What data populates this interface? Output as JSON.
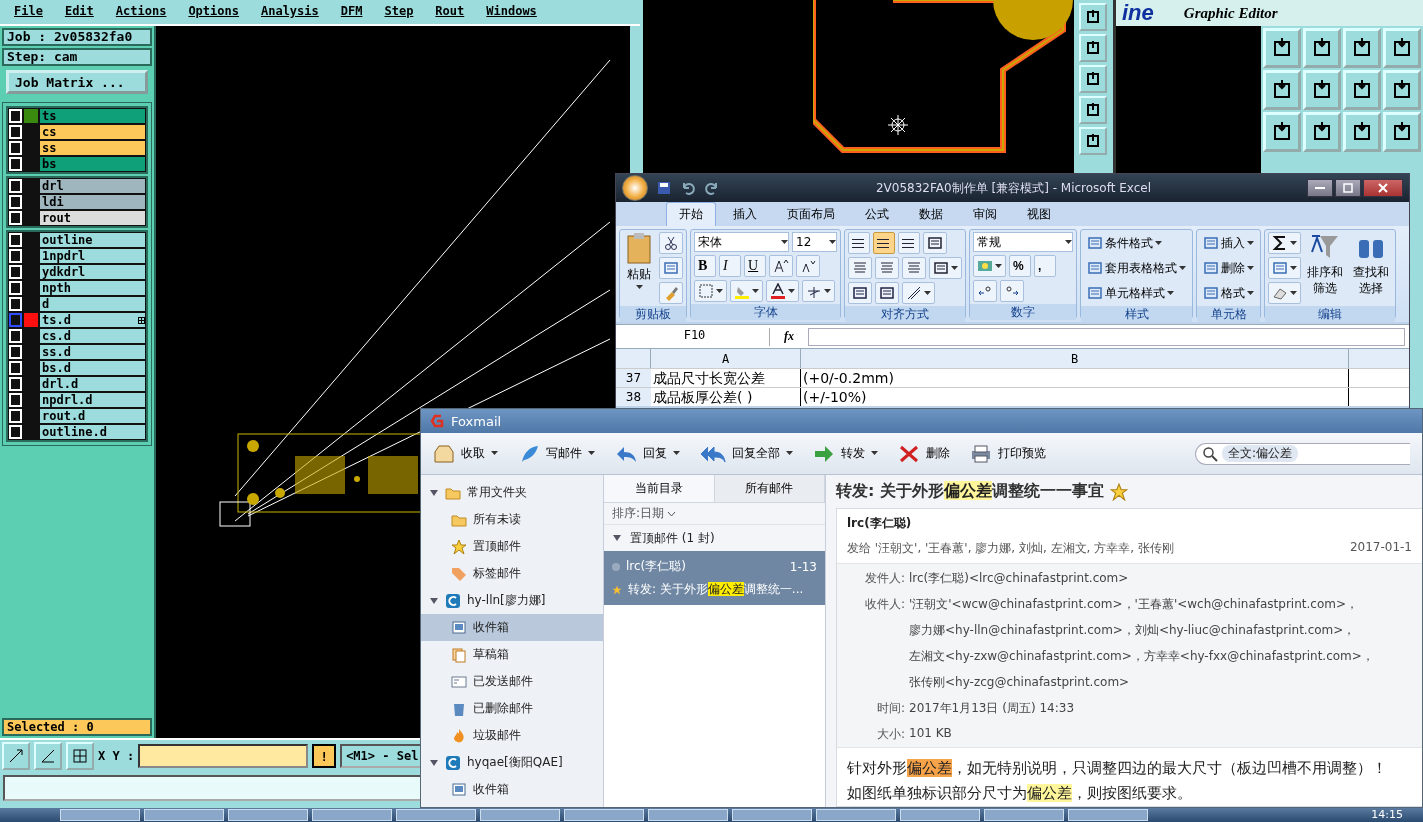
{
  "cam": {
    "menu": [
      "File",
      "Edit",
      "Actions",
      "Options",
      "Analysis",
      "DFM",
      "Step",
      "Rout",
      "Windows"
    ],
    "job": "Job : 2v05832fa0",
    "step": "Step: cam",
    "matrix_button": "Job Matrix ...",
    "layer_groups": [
      [
        {
          "name": "ts",
          "color": "#0fa07a",
          "checked": false,
          "work": true,
          "highlighted": false
        },
        {
          "name": "cs",
          "color": "#fcc85a",
          "checked": false,
          "work": false,
          "highlighted": false
        },
        {
          "name": "ss",
          "color": "#fcc85a",
          "checked": false,
          "work": false,
          "highlighted": false
        },
        {
          "name": "bs",
          "color": "#0fa07a",
          "checked": false,
          "work": false,
          "highlighted": false
        }
      ],
      [
        {
          "name": "drl",
          "color": "#a0b6be",
          "checked": false,
          "work": false,
          "highlighted": false
        },
        {
          "name": "ldi",
          "color": "#a0b6be",
          "checked": false,
          "work": false,
          "highlighted": false
        },
        {
          "name": "rout",
          "color": "#dcdcdc",
          "checked": false,
          "work": false,
          "highlighted": false
        }
      ],
      [
        {
          "name": "outline",
          "color": "#9cdcdc",
          "checked": false,
          "work": false,
          "highlighted": false
        },
        {
          "name": "1npdrl",
          "color": "#9cdcdc",
          "checked": false,
          "work": false,
          "highlighted": false
        },
        {
          "name": "ydkdrl",
          "color": "#9cdcdc",
          "checked": false,
          "work": false,
          "highlighted": false
        },
        {
          "name": "npth",
          "color": "#9cdcdc",
          "checked": false,
          "work": false,
          "highlighted": false
        },
        {
          "name": "d",
          "color": "#9cdcdc",
          "checked": false,
          "work": false,
          "highlighted": false
        },
        {
          "name": "ts.d",
          "color": "#9cdcdc",
          "checked": false,
          "work": false,
          "highlighted": true
        },
        {
          "name": "cs.d",
          "color": "#9cdcdc",
          "checked": false,
          "work": false,
          "highlighted": false
        },
        {
          "name": "ss.d",
          "color": "#9cdcdc",
          "checked": false,
          "work": false,
          "highlighted": false
        },
        {
          "name": "bs.d",
          "color": "#9cdcdc",
          "checked": false,
          "work": false,
          "highlighted": false
        },
        {
          "name": "drl.d",
          "color": "#9cdcdc",
          "checked": false,
          "work": false,
          "highlighted": false
        },
        {
          "name": "npdrl.d",
          "color": "#9cdcdc",
          "checked": false,
          "work": false,
          "highlighted": false
        },
        {
          "name": "rout.d",
          "color": "#9cdcdc",
          "checked": false,
          "work": false,
          "highlighted": false
        },
        {
          "name": "outline.d",
          "color": "#9cdcdc",
          "checked": false,
          "work": false,
          "highlighted": false
        }
      ]
    ],
    "selected_count": "Selected : 0",
    "xy_label": "X Y :",
    "alert_button": "!",
    "mode": "<M1> - Sel",
    "logo": "ine",
    "editor_title": "Graphic Editor"
  },
  "excel": {
    "title": "2V05832FA0制作单  [兼容模式] - Microsoft Excel",
    "tabs": [
      {
        "label": "开始",
        "selected": true
      },
      {
        "label": "插入",
        "selected": false
      },
      {
        "label": "页面布局",
        "selected": false
      },
      {
        "label": "公式",
        "selected": false
      },
      {
        "label": "数据",
        "selected": false
      },
      {
        "label": "审阅",
        "selected": false
      },
      {
        "label": "视图",
        "selected": false
      }
    ],
    "groups": [
      {
        "kind": "clipboard",
        "label": "剪贴板",
        "paste": "粘贴"
      },
      {
        "kind": "font",
        "label": "字体",
        "font": "宋体",
        "size": "12",
        "styles": [
          "B",
          "I",
          "U"
        ]
      },
      {
        "kind": "align",
        "label": "对齐方式",
        "buttons": [
          {
            "selected": false
          },
          {
            "selected": true
          },
          {
            "selected": false
          }
        ]
      },
      {
        "kind": "number",
        "label": "数字",
        "format": "常规",
        "symbols": [
          "%",
          ","
        ]
      },
      {
        "kind": "list",
        "label": "样式",
        "items": [
          "条件格式",
          "套用表格格式",
          "单元格样式"
        ]
      },
      {
        "kind": "list",
        "label": "单元格",
        "items": [
          "插入",
          "删除",
          "格式"
        ]
      },
      {
        "kind": "editing",
        "label": "编辑",
        "items": [
          "排序和筛选",
          "查找和选择"
        ]
      }
    ],
    "name_box": "F10",
    "fx": "fx",
    "columns": [
      "A",
      "B"
    ],
    "rows": [
      {
        "num": "37",
        "cells": [
          "成品尺寸长宽公差",
          "(+0/-0.2mm)"
        ]
      },
      {
        "num": "38",
        "cells": [
          "成品板厚公差(  )",
          "(+/-10%)"
        ]
      }
    ]
  },
  "foxmail": {
    "title": "Foxmail",
    "toolbar": [
      {
        "label": "收取",
        "menu": true
      },
      {
        "label": "写邮件",
        "menu": true
      },
      {
        "label": "回复",
        "menu": true
      },
      {
        "label": "回复全部",
        "menu": true
      },
      {
        "label": "转发",
        "menu": true
      },
      {
        "label": "删除",
        "menu": false
      },
      {
        "label": "打印预览",
        "menu": false
      }
    ],
    "search": "全文:偏公差",
    "folders": [
      {
        "label": "常用文件夹",
        "kind": "group",
        "selected": false,
        "children": [
          {
            "label": "所有未读",
            "kind": "folder",
            "selected": false
          },
          {
            "label": "置顶邮件",
            "kind": "star",
            "selected": false
          },
          {
            "label": "标签邮件",
            "kind": "tag",
            "selected": false
          }
        ]
      },
      {
        "label": "hy-lln[廖力娜]",
        "kind": "account",
        "selected": false,
        "children": [
          {
            "label": "收件箱",
            "kind": "inbox",
            "selected": true
          },
          {
            "label": "草稿箱",
            "kind": "draft",
            "selected": false
          },
          {
            "label": "已发送邮件",
            "kind": "sent",
            "selected": false
          },
          {
            "label": "已删除邮件",
            "kind": "trash",
            "selected": false
          },
          {
            "label": "垃圾邮件",
            "kind": "junk",
            "selected": false
          }
        ]
      },
      {
        "label": "hyqae[衡阳QAE]",
        "kind": "account",
        "selected": false,
        "children": [
          {
            "label": "收件箱",
            "kind": "inbox",
            "selected": false
          }
        ]
      }
    ],
    "list_tabs": [
      {
        "label": "当前目录",
        "selected": true
      },
      {
        "label": "所有邮件",
        "selected": false
      }
    ],
    "sort": "排序:日期",
    "group": "置顶邮件 (1 封)",
    "messages": [
      {
        "sender": "lrc(李仁聪)",
        "date": "1-13",
        "selected": true,
        "starred": true,
        "subject": [
          {
            "text": "转发: 关于外形"
          },
          {
            "text": "偏公差",
            "color": "#ffee00"
          },
          {
            "text": "调整统一..."
          }
        ]
      }
    ],
    "reading": {
      "subject": [
        {
          "text": "转发: 关于外形"
        },
        {
          "text": "偏公差",
          "color": "#fff59a"
        },
        {
          "text": "调整统一一事宜"
        }
      ],
      "starred": true,
      "from_name": "lrc(李仁聪)",
      "to_line": "发给 '汪朝文', '王春蕙', 廖力娜, 刘灿, 左湘文, 方幸幸, 张传刚",
      "date": "2017-01-1",
      "headers": [
        {
          "label": "发件人:",
          "lines": [
            "lrc(李仁聪)<lrc@chinafastprint.com>"
          ]
        },
        {
          "label": "收件人:",
          "lines": [
            "'汪朝文'<wcw@chinafastprint.com>，'王春蕙'<wch@chinafastprint.com>，",
            "廖力娜<hy-lln@chinafastprint.com>，刘灿<hy-liuc@chinafastprint.com>，",
            "左湘文<hy-zxw@chinafastprint.com>，方幸幸<hy-fxx@chinafastprint.com>，",
            "张传刚<hy-zcg@chinafastprint.com>"
          ]
        },
        {
          "label": "时间:",
          "lines": [
            "2017年1月13日 (周五) 14:33"
          ]
        },
        {
          "label": "大小:",
          "lines": [
            "101 KB"
          ]
        }
      ],
      "body": [
        [
          {
            "text": "针对外形"
          },
          {
            "text": "偏公差",
            "color": "#f7a34a"
          },
          {
            "text": "，如无特别说明，只调整四边的最大尺寸（板边凹槽不用调整）！"
          }
        ],
        [
          {
            "text": "如图纸单独标识部分尺寸为"
          },
          {
            "text": "偏公差",
            "color": "#fff59a"
          },
          {
            "text": "，则按图纸要求。"
          }
        ]
      ]
    }
  },
  "taskbar": {
    "clock": "14:15"
  }
}
